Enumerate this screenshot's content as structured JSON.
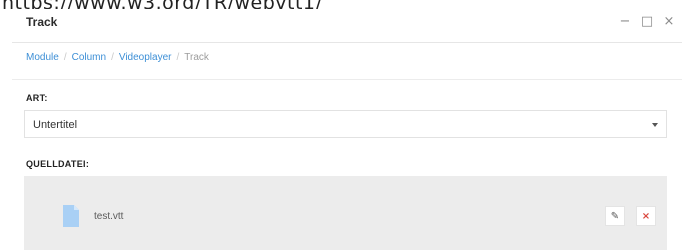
{
  "background_url": "https://www.w3.org/TR/webvtt1/",
  "dialog": {
    "title": "Track",
    "controls": {
      "minimize": "−",
      "maximize": "□",
      "close": "×"
    }
  },
  "breadcrumb": {
    "items": [
      "Module",
      "Column",
      "Videoplayer"
    ],
    "separator": "/",
    "current": "Track"
  },
  "fields": {
    "art": {
      "label": "ART:",
      "value": "Untertitel"
    },
    "quelldatei": {
      "label": "QUELLDATEI:",
      "file_name": "test.vtt"
    }
  },
  "icons": {
    "file": "file-icon",
    "edit": "pencil-icon",
    "delete": "close-icon",
    "dropdown": "chevron-down-icon"
  },
  "colors": {
    "link": "#3d8fd6",
    "file_icon": "#a9d0f5",
    "delete": "#d9443b",
    "panel_bg": "#ececec"
  }
}
